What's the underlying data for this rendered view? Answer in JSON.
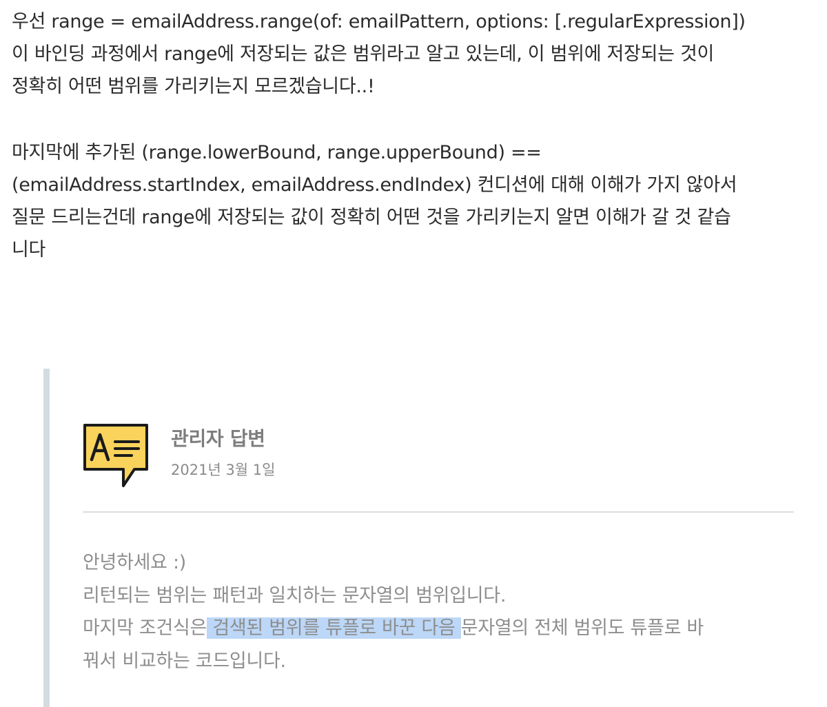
{
  "question": {
    "line1": "우선 range = emailAddress.range(of: emailPattern, options: [.regularExpression])",
    "line2": "이 바인딩 과정에서 range에 저장되는 값은 범위라고 알고 있는데, 이 범위에 저장되는 것이",
    "line3": "정확히 어떤 범위를 가리키는지 모르겠습니다..!",
    "line4": "마지막에 추가된  (range.lowerBound, range.upperBound) ==",
    "line5": "(emailAddress.startIndex, emailAddress.endIndex) 컨디션에 대해 이해가 가지 않아서",
    "line6": "질문 드리는건데 range에 저장되는 값이 정확히 어떤 것을 가리키는지 알면 이해가 갈 것 같습",
    "line7": "니다"
  },
  "answer": {
    "icon": "speech-bubble-text-icon",
    "title": "관리자 답변",
    "date": "2021년 3월 1일",
    "greeting": "안녕하세요 :)",
    "line2": "리턴되는 범위는 패턴과 일치하는 문자열의 범위입니다.",
    "line3_before": "마지막 조건식은",
    "line3_highlight": " 검색된 범위를 튜플로 바꾼 다음 ",
    "line3_after": "문자열의 전체 범위도 튜플로 바",
    "line4": "꿔서 비교하는 코드입니다."
  },
  "colors": {
    "icon_fill": "#f9d35c",
    "quote_bar": "#d3dcdf",
    "selection_highlight": "#bcd7f7"
  }
}
